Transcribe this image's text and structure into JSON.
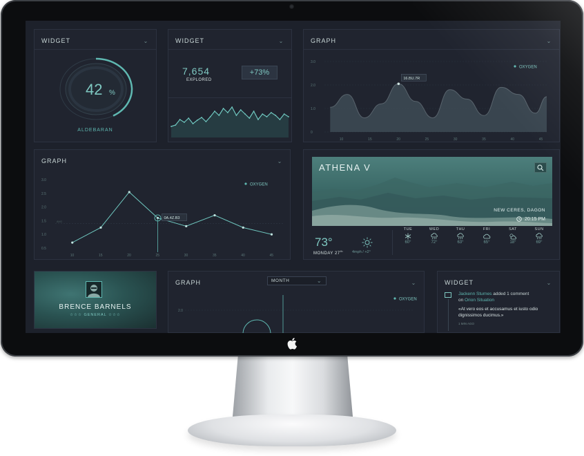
{
  "widgets": {
    "gauge": {
      "title": "WIDGET",
      "value": "42",
      "unit": "%",
      "percent": 42,
      "label": "ALDEBARAN"
    },
    "explored": {
      "title": "WIDGET",
      "value": "7,654",
      "label": "EXPLORED",
      "delta": "+73%",
      "sparkline": [
        40,
        38,
        30,
        34,
        28,
        36,
        31,
        27,
        33,
        26,
        18,
        24,
        14,
        20,
        12,
        24,
        16,
        22,
        28,
        18,
        30,
        22,
        26,
        20,
        24,
        30,
        22,
        26
      ]
    },
    "feed": {
      "title": "WIDGET",
      "author": "Jackenn Sturnes",
      "action": "added 1 comment",
      "on": "on",
      "target": "Orion Situation",
      "quote": "«At vero eos et accusamus et iusto odio dignissimos ducimus.»",
      "time": "1 MIN AGO"
    }
  },
  "graph_top": {
    "title": "GRAPH",
    "legend": "OXYGEN",
    "tooltip": "16.BU.7R",
    "yticks": [
      "3.0",
      "2.0",
      "1.0",
      "0"
    ],
    "xticks": [
      "10",
      "15",
      "20",
      "25",
      "30",
      "35",
      "40",
      "45"
    ]
  },
  "graph_mid": {
    "title": "GRAPH",
    "legend": "OXYGEN",
    "tooltip": "0A.4Z.B3",
    "yticks": [
      "3.0",
      "2.5",
      "2.0",
      "1.5",
      "1.0",
      "0.5"
    ],
    "xticks": [
      "10",
      "15",
      "20",
      "25",
      "30",
      "35",
      "40",
      "45"
    ],
    "ref_label": "AVG"
  },
  "graph_bottom": {
    "title": "GRAPH",
    "select_value": "MONTH",
    "legend": "OXYGEN",
    "yticks": [
      "2.0"
    ]
  },
  "weather": {
    "city": "ATHENA V",
    "location": "NEW CERES, DAGON",
    "time": "20:15 PM",
    "temp": "73°",
    "date": "MONDAY 27",
    "date_sup": "th",
    "wind": "4mph / +2°",
    "forecast": [
      {
        "day": "TUE",
        "temp": "60°",
        "icon": "snowflake-icon"
      },
      {
        "day": "WED",
        "temp": "72°",
        "icon": "rain-cloud-icon"
      },
      {
        "day": "THU",
        "temp": "63°",
        "icon": "rain-cloud-icon"
      },
      {
        "day": "FRI",
        "temp": "65°",
        "icon": "cloud-icon"
      },
      {
        "day": "SAT",
        "temp": "18°",
        "icon": "partly-cloudy-icon"
      },
      {
        "day": "SUN",
        "temp": "69°",
        "icon": "rain-cloud-icon"
      }
    ]
  },
  "profile": {
    "name": "BRENCE BARNELS",
    "rank": "☆☆☆ GENERAL ☆☆☆"
  },
  "chart_data": [
    {
      "type": "area",
      "title": "GRAPH",
      "series": [
        {
          "name": "OXYGEN",
          "x": [
            8,
            11,
            14,
            17,
            20,
            23,
            26,
            29,
            32,
            35,
            38,
            41,
            44,
            46
          ],
          "values": [
            1.05,
            1.6,
            0.6,
            1.2,
            2.05,
            1.3,
            0.6,
            1.8,
            1.4,
            0.7,
            1.9,
            1.6,
            0.8,
            1.5
          ]
        }
      ],
      "categories": [
        "10",
        "15",
        "20",
        "25",
        "30",
        "35",
        "40",
        "45"
      ],
      "ylim": [
        0,
        3.0
      ]
    },
    {
      "type": "line",
      "title": "GRAPH",
      "series": [
        {
          "name": "OXYGEN",
          "x": [
            10,
            15,
            20,
            25,
            30,
            35,
            40,
            45
          ],
          "values": [
            0.7,
            1.25,
            2.55,
            1.6,
            1.3,
            1.7,
            1.25,
            1.0
          ]
        }
      ],
      "categories": [
        "10",
        "15",
        "20",
        "25",
        "30",
        "35",
        "40",
        "45"
      ],
      "ylim": [
        0.5,
        3.0
      ]
    }
  ]
}
